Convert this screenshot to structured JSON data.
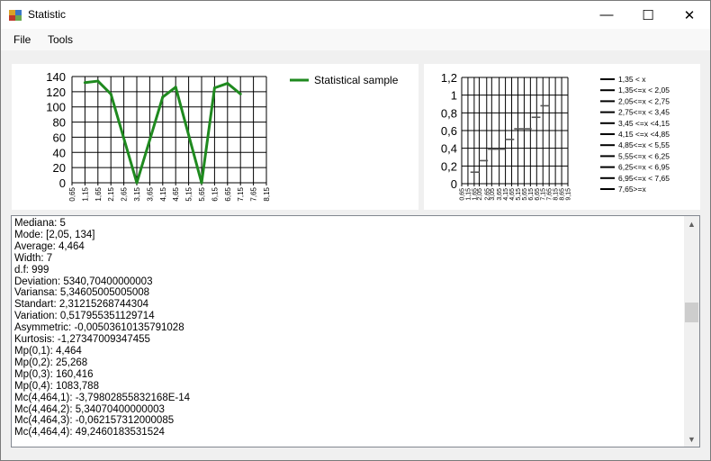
{
  "window": {
    "title": "Statistic",
    "controls": {
      "minimize": "—",
      "maximize": "☐",
      "close": "✕"
    }
  },
  "menu": {
    "items": [
      "File",
      "Tools"
    ]
  },
  "colors": {
    "series": "#1f8a1f",
    "grid": "#000000",
    "background": "#f0f0f0"
  },
  "chart_data": [
    {
      "type": "line",
      "title": "",
      "x": [
        "0,65",
        "1,15",
        "1,65",
        "2,15",
        "2,65",
        "3,15",
        "3,65",
        "4,15",
        "4,65",
        "5,15",
        "5,65",
        "6,15",
        "6,65",
        "7,15",
        "7,65",
        "8,15"
      ],
      "y_ticks": [
        "0",
        "20",
        "40",
        "60",
        "80",
        "100",
        "120",
        "140"
      ],
      "ylim": [
        0,
        140
      ],
      "grid": true,
      "legend_position": "top-right",
      "series": [
        {
          "name": "Statistical sample",
          "color": "#1f8a1f",
          "points": [
            [
              1.15,
              132
            ],
            [
              1.65,
              134
            ],
            [
              2.15,
              117
            ],
            [
              3.15,
              0
            ],
            [
              4.15,
              113
            ],
            [
              4.65,
              126
            ],
            [
              5.65,
              0
            ],
            [
              6.15,
              125
            ],
            [
              6.65,
              131
            ],
            [
              7.15,
              117
            ]
          ]
        }
      ]
    },
    {
      "type": "bar",
      "title": "",
      "x": [
        "0,65",
        "1,15",
        "1,65",
        "2,05",
        "2,65",
        "3,05",
        "3,65",
        "4,15",
        "4,65",
        "5,15",
        "5,65",
        "6,15",
        "6,65",
        "7,15",
        "7,65",
        "8,15",
        "8,65",
        "9,15"
      ],
      "y_ticks": [
        "0",
        "0,2",
        "0,4",
        "0,6",
        "0,8",
        "1",
        "1,2"
      ],
      "ylim": [
        0,
        1.2
      ],
      "grid": true,
      "legend_position": "right",
      "legend": [
        "1,35 < x",
        "1,35<=x < 2,05",
        "2,05<=x < 2,75",
        "2,75<=x < 3,45",
        "3,45 <=x <4,15",
        "4,15 <=x <4,85",
        "4,85<=x < 5,55",
        "5,55<=x < 6,25",
        "6,25<=x < 6,95",
        "6,95<=x < 7,65",
        "7,65>=x"
      ],
      "steps": [
        {
          "from": 1.35,
          "to": 2.05,
          "value": 0.13
        },
        {
          "from": 2.05,
          "to": 2.75,
          "value": 0.26
        },
        {
          "from": 2.75,
          "to": 3.45,
          "value": 0.39
        },
        {
          "from": 3.45,
          "to": 4.15,
          "value": 0.39
        },
        {
          "from": 4.15,
          "to": 4.85,
          "value": 0.5
        },
        {
          "from": 4.85,
          "to": 5.55,
          "value": 0.62
        },
        {
          "from": 5.55,
          "to": 6.25,
          "value": 0.62
        },
        {
          "from": 6.25,
          "to": 6.95,
          "value": 0.75
        },
        {
          "from": 6.95,
          "to": 7.65,
          "value": 0.88
        }
      ]
    }
  ],
  "output": {
    "lines": [
      "Mediana: 5",
      "Mode: [2,05, 134]",
      "Average: 4,464",
      "Width: 7",
      "d.f: 999",
      "Deviation: 5340,70400000003",
      "Variansa: 5,34605005005008",
      "Standart: 2,31215268744304",
      "Variation: 0,517955351129714",
      "Asymmetric: -0,00503610135791028",
      "Kurtosis: -1,27347009347455",
      "Mp(0,1): 4,464",
      "Mp(0,2): 25,268",
      "Mp(0,3): 160,416",
      "Mp(0,4): 1083,788",
      "Mc(4,464,1): -3,79802855832168E-14",
      "Mc(4,464,2): 5,34070400000003",
      "Mc(4,464,3): -0,062157312000085",
      "Mc(4,464,4): 49,2460183531524"
    ]
  }
}
